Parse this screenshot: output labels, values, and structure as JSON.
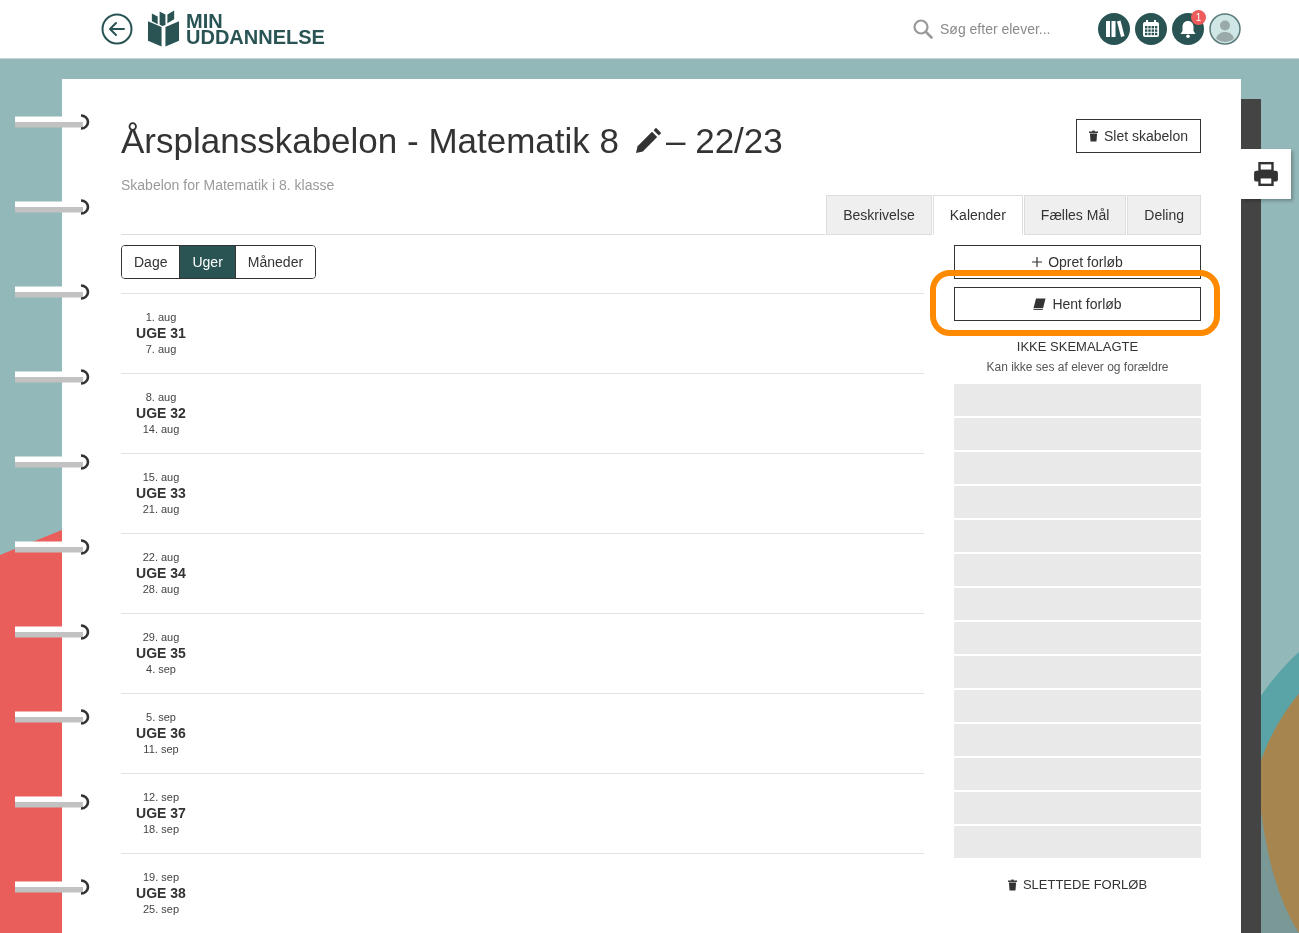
{
  "header": {
    "logo": {
      "line_1": "MIN",
      "line_2": "UDDANNELSE"
    },
    "search": {
      "placeholder": "Søg efter elever..."
    },
    "notification_badge": "1"
  },
  "template": {
    "title": "Årsplansskabelon - Matematik 8",
    "year": "– 22/23",
    "subtitle": "Skabelon for Matematik i 8. klasse",
    "delete_button": "Slet skabelon"
  },
  "tabs": [
    {
      "label": "Beskrivelse",
      "selected": false
    },
    {
      "label": "Kalender",
      "selected": true
    },
    {
      "label": "Fælles Mål",
      "selected": false
    },
    {
      "label": "Deling",
      "selected": false
    }
  ],
  "view_switch": [
    {
      "label": "Dage",
      "selected": false
    },
    {
      "label": "Uger",
      "selected": true
    },
    {
      "label": "Måneder",
      "selected": false
    }
  ],
  "weeks": [
    {
      "start": "1. aug",
      "label": "UGE 31",
      "end": "7. aug"
    },
    {
      "start": "8. aug",
      "label": "UGE 32",
      "end": "14. aug"
    },
    {
      "start": "15. aug",
      "label": "UGE 33",
      "end": "21. aug"
    },
    {
      "start": "22. aug",
      "label": "UGE 34",
      "end": "28. aug"
    },
    {
      "start": "29. aug",
      "label": "UGE 35",
      "end": "4. sep"
    },
    {
      "start": "5. sep",
      "label": "UGE 36",
      "end": "11. sep"
    },
    {
      "start": "12. sep",
      "label": "UGE 37",
      "end": "18. sep"
    },
    {
      "start": "19. sep",
      "label": "UGE 38",
      "end": "25. sep"
    }
  ],
  "unscheduled": {
    "buttons": [
      {
        "kind": "create",
        "label": "Opret forløb",
        "highlighted": false
      },
      {
        "kind": "fetch",
        "label": "Hent forløb",
        "highlighted": true
      }
    ],
    "heading": "IKKE SKEMALAGTE",
    "note": "Kan ikke ses af elever og forældre",
    "slots": [
      {
        "filled": false
      },
      {
        "filled": false
      },
      {
        "filled": false
      },
      {
        "filled": false
      },
      {
        "filled": false
      },
      {
        "filled": false
      },
      {
        "filled": false
      },
      {
        "filled": false
      },
      {
        "filled": false
      },
      {
        "filled": false
      },
      {
        "filled": false
      },
      {
        "filled": false
      },
      {
        "filled": false
      },
      {
        "filled": false
      }
    ],
    "deleted_link": "SLETTEDE FORLØB"
  }
}
